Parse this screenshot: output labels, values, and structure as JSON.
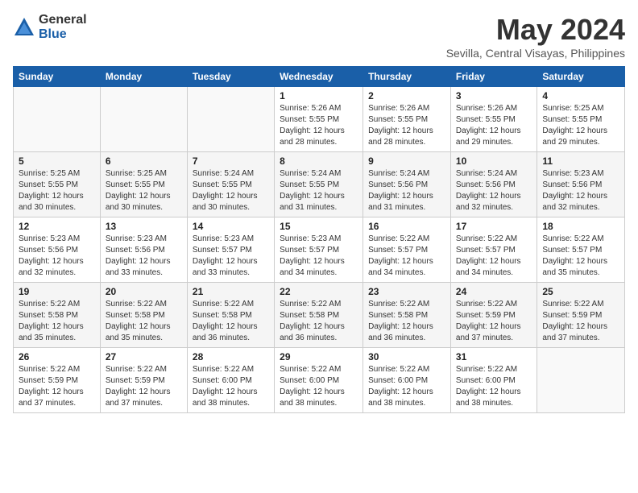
{
  "header": {
    "logo_general": "General",
    "logo_blue": "Blue",
    "month": "May 2024",
    "location": "Sevilla, Central Visayas, Philippines"
  },
  "days_of_week": [
    "Sunday",
    "Monday",
    "Tuesday",
    "Wednesday",
    "Thursday",
    "Friday",
    "Saturday"
  ],
  "weeks": [
    [
      {
        "day": "",
        "info": ""
      },
      {
        "day": "",
        "info": ""
      },
      {
        "day": "",
        "info": ""
      },
      {
        "day": "1",
        "info": "Sunrise: 5:26 AM\nSunset: 5:55 PM\nDaylight: 12 hours\nand 28 minutes."
      },
      {
        "day": "2",
        "info": "Sunrise: 5:26 AM\nSunset: 5:55 PM\nDaylight: 12 hours\nand 28 minutes."
      },
      {
        "day": "3",
        "info": "Sunrise: 5:26 AM\nSunset: 5:55 PM\nDaylight: 12 hours\nand 29 minutes."
      },
      {
        "day": "4",
        "info": "Sunrise: 5:25 AM\nSunset: 5:55 PM\nDaylight: 12 hours\nand 29 minutes."
      }
    ],
    [
      {
        "day": "5",
        "info": "Sunrise: 5:25 AM\nSunset: 5:55 PM\nDaylight: 12 hours\nand 30 minutes."
      },
      {
        "day": "6",
        "info": "Sunrise: 5:25 AM\nSunset: 5:55 PM\nDaylight: 12 hours\nand 30 minutes."
      },
      {
        "day": "7",
        "info": "Sunrise: 5:24 AM\nSunset: 5:55 PM\nDaylight: 12 hours\nand 30 minutes."
      },
      {
        "day": "8",
        "info": "Sunrise: 5:24 AM\nSunset: 5:55 PM\nDaylight: 12 hours\nand 31 minutes."
      },
      {
        "day": "9",
        "info": "Sunrise: 5:24 AM\nSunset: 5:56 PM\nDaylight: 12 hours\nand 31 minutes."
      },
      {
        "day": "10",
        "info": "Sunrise: 5:24 AM\nSunset: 5:56 PM\nDaylight: 12 hours\nand 32 minutes."
      },
      {
        "day": "11",
        "info": "Sunrise: 5:23 AM\nSunset: 5:56 PM\nDaylight: 12 hours\nand 32 minutes."
      }
    ],
    [
      {
        "day": "12",
        "info": "Sunrise: 5:23 AM\nSunset: 5:56 PM\nDaylight: 12 hours\nand 32 minutes."
      },
      {
        "day": "13",
        "info": "Sunrise: 5:23 AM\nSunset: 5:56 PM\nDaylight: 12 hours\nand 33 minutes."
      },
      {
        "day": "14",
        "info": "Sunrise: 5:23 AM\nSunset: 5:57 PM\nDaylight: 12 hours\nand 33 minutes."
      },
      {
        "day": "15",
        "info": "Sunrise: 5:23 AM\nSunset: 5:57 PM\nDaylight: 12 hours\nand 34 minutes."
      },
      {
        "day": "16",
        "info": "Sunrise: 5:22 AM\nSunset: 5:57 PM\nDaylight: 12 hours\nand 34 minutes."
      },
      {
        "day": "17",
        "info": "Sunrise: 5:22 AM\nSunset: 5:57 PM\nDaylight: 12 hours\nand 34 minutes."
      },
      {
        "day": "18",
        "info": "Sunrise: 5:22 AM\nSunset: 5:57 PM\nDaylight: 12 hours\nand 35 minutes."
      }
    ],
    [
      {
        "day": "19",
        "info": "Sunrise: 5:22 AM\nSunset: 5:58 PM\nDaylight: 12 hours\nand 35 minutes."
      },
      {
        "day": "20",
        "info": "Sunrise: 5:22 AM\nSunset: 5:58 PM\nDaylight: 12 hours\nand 35 minutes."
      },
      {
        "day": "21",
        "info": "Sunrise: 5:22 AM\nSunset: 5:58 PM\nDaylight: 12 hours\nand 36 minutes."
      },
      {
        "day": "22",
        "info": "Sunrise: 5:22 AM\nSunset: 5:58 PM\nDaylight: 12 hours\nand 36 minutes."
      },
      {
        "day": "23",
        "info": "Sunrise: 5:22 AM\nSunset: 5:58 PM\nDaylight: 12 hours\nand 36 minutes."
      },
      {
        "day": "24",
        "info": "Sunrise: 5:22 AM\nSunset: 5:59 PM\nDaylight: 12 hours\nand 37 minutes."
      },
      {
        "day": "25",
        "info": "Sunrise: 5:22 AM\nSunset: 5:59 PM\nDaylight: 12 hours\nand 37 minutes."
      }
    ],
    [
      {
        "day": "26",
        "info": "Sunrise: 5:22 AM\nSunset: 5:59 PM\nDaylight: 12 hours\nand 37 minutes."
      },
      {
        "day": "27",
        "info": "Sunrise: 5:22 AM\nSunset: 5:59 PM\nDaylight: 12 hours\nand 37 minutes."
      },
      {
        "day": "28",
        "info": "Sunrise: 5:22 AM\nSunset: 6:00 PM\nDaylight: 12 hours\nand 38 minutes."
      },
      {
        "day": "29",
        "info": "Sunrise: 5:22 AM\nSunset: 6:00 PM\nDaylight: 12 hours\nand 38 minutes."
      },
      {
        "day": "30",
        "info": "Sunrise: 5:22 AM\nSunset: 6:00 PM\nDaylight: 12 hours\nand 38 minutes."
      },
      {
        "day": "31",
        "info": "Sunrise: 5:22 AM\nSunset: 6:00 PM\nDaylight: 12 hours\nand 38 minutes."
      },
      {
        "day": "",
        "info": ""
      }
    ]
  ]
}
